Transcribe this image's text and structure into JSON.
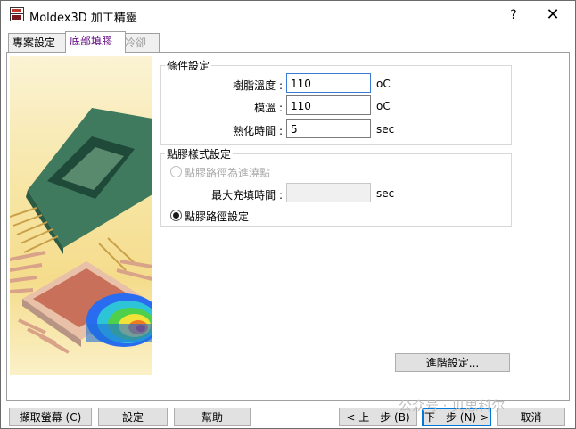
{
  "window": {
    "title": "Moldex3D 加工精靈",
    "help_label": "?",
    "close_label": "✕"
  },
  "tabs": [
    {
      "label": "專案設定"
    },
    {
      "label": "底部填膠"
    },
    {
      "label": "冷卻"
    }
  ],
  "condition_group": {
    "title": "條件設定",
    "resin_temp_label": "樹脂溫度 :",
    "resin_temp_value": "110",
    "resin_temp_unit": "oC",
    "mold_temp_label": "模溫 :",
    "mold_temp_value": "110",
    "mold_temp_unit": "oC",
    "cure_time_label": "熟化時間 :",
    "cure_time_value": "5",
    "cure_time_unit": "sec"
  },
  "dispense_group": {
    "title": "點膠樣式設定",
    "radio_path_as_gate_label": "點膠路徑為進澆點",
    "max_fill_time_label": "最大充填時間 :",
    "max_fill_time_value": "--",
    "max_fill_time_unit": "sec",
    "radio_path_setting_label": "點膠路徑設定",
    "selected": "path_setting"
  },
  "advanced_button": "進階設定...",
  "footer": {
    "capture_label": "擷取螢幕 (C)",
    "settings_label": "設定",
    "help_label": "幫助",
    "prev_label": "< 上一步 (B)",
    "next_label": "下一步 (N) >",
    "cancel_label": "取消"
  },
  "watermark": "公众号 · 贝思科尔"
}
